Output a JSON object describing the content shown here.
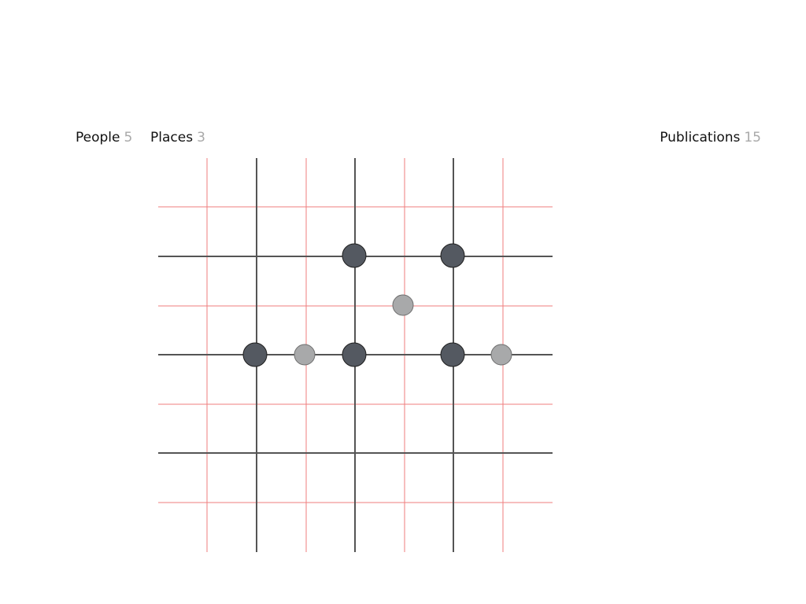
{
  "tabs": {
    "people": {
      "label": "People",
      "count": "5"
    },
    "places": {
      "label": "Places",
      "count": "3"
    },
    "publications": {
      "label": "Publications",
      "count": "15"
    }
  },
  "colors": {
    "major_line": "#555555",
    "minor_line": "#ef7d7d",
    "node_dark": "#545961",
    "node_light": "#a8a9aa"
  },
  "network": {
    "people": [
      {
        "col": 2,
        "row": 1
      },
      {
        "col": 4,
        "row": 1
      },
      {
        "col": 0,
        "row": 2
      },
      {
        "col": 2,
        "row": 2
      },
      {
        "col": 4,
        "row": 2
      }
    ],
    "places": [
      {
        "col": 3,
        "row": 1.5
      },
      {
        "col": 1,
        "row": 2
      },
      {
        "col": 5,
        "row": 2
      }
    ]
  }
}
